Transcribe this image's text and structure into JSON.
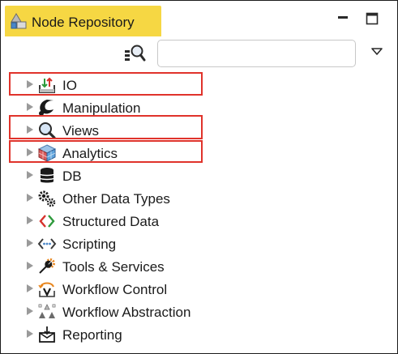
{
  "header": {
    "title": "Node Repository",
    "tab_icon": "node-repository-icon",
    "minimize_icon": "minimize-icon",
    "maximize_icon": "maximize-icon"
  },
  "search": {
    "value": "",
    "placeholder": "",
    "search_icon": "search-icon",
    "menu_icon": "dropdown-arrow-icon"
  },
  "tree": {
    "items": [
      {
        "label": "IO",
        "icon": "io-icon"
      },
      {
        "label": "Manipulation",
        "icon": "manipulation-icon"
      },
      {
        "label": "Views",
        "icon": "views-magnifier-icon"
      },
      {
        "label": "Analytics",
        "icon": "analytics-cube-icon"
      },
      {
        "label": "DB",
        "icon": "database-icon"
      },
      {
        "label": "Other Data Types",
        "icon": "gears-icon"
      },
      {
        "label": "Structured Data",
        "icon": "code-brackets-icon"
      },
      {
        "label": "Scripting",
        "icon": "script-icon"
      },
      {
        "label": "Tools & Services",
        "icon": "tools-icon"
      },
      {
        "label": "Workflow Control",
        "icon": "workflow-control-icon"
      },
      {
        "label": "Workflow Abstraction",
        "icon": "workflow-abstraction-icon"
      },
      {
        "label": "Reporting",
        "icon": "reporting-icon"
      }
    ]
  },
  "colors": {
    "tab_background": "#f6d743",
    "highlight_border": "#e0332b",
    "expand_arrow": "#9a9a9a"
  }
}
